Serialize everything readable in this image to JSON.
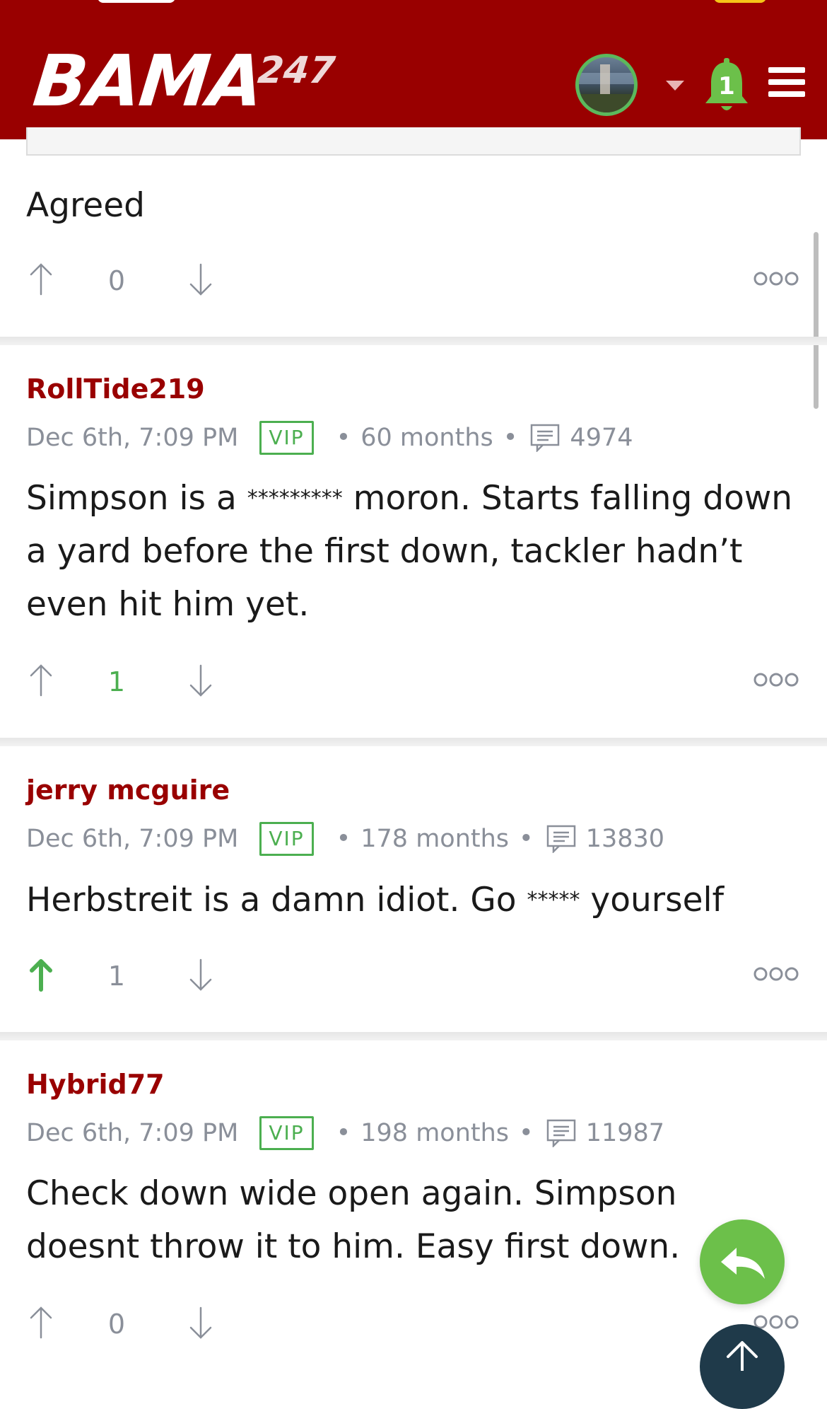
{
  "header": {
    "logo_main": "BAMA",
    "logo_sup": "247",
    "notification_count": "1",
    "colors": {
      "brand": "#990000",
      "accent_green": "#5cb85c"
    },
    "icons": [
      "avatar",
      "caret-down-icon",
      "bell-icon",
      "hamburger-menu-icon"
    ]
  },
  "posts": [
    {
      "body": "Agreed",
      "votes": "0"
    },
    {
      "author": "RollTide219",
      "date": "Dec 6th, 7:09 PM",
      "badge": "VIP",
      "tenure": "60 months",
      "post_count": "4974",
      "body_1": "Simpson is a ",
      "censored": "*********",
      "body_2": " moron. Starts falling down a yard before the first down, tackler hadn’t even hit him yet.",
      "votes": "1"
    },
    {
      "author": "jerry mcguire",
      "date": "Dec 6th, 7:09 PM",
      "badge": "VIP",
      "tenure": "178 months",
      "post_count": "13830",
      "body_1": "Herbstreit is a damn idiot. Go ",
      "censored": "*****",
      "body_2": " yourself",
      "votes": "1"
    },
    {
      "author": "Hybrid77",
      "date": "Dec 6th, 7:09 PM",
      "badge": "VIP",
      "tenure": "198 months",
      "post_count": "11987",
      "body": "Check down wide open again. Simpson doesnt throw it to him. Easy first down.",
      "votes": "0"
    }
  ]
}
